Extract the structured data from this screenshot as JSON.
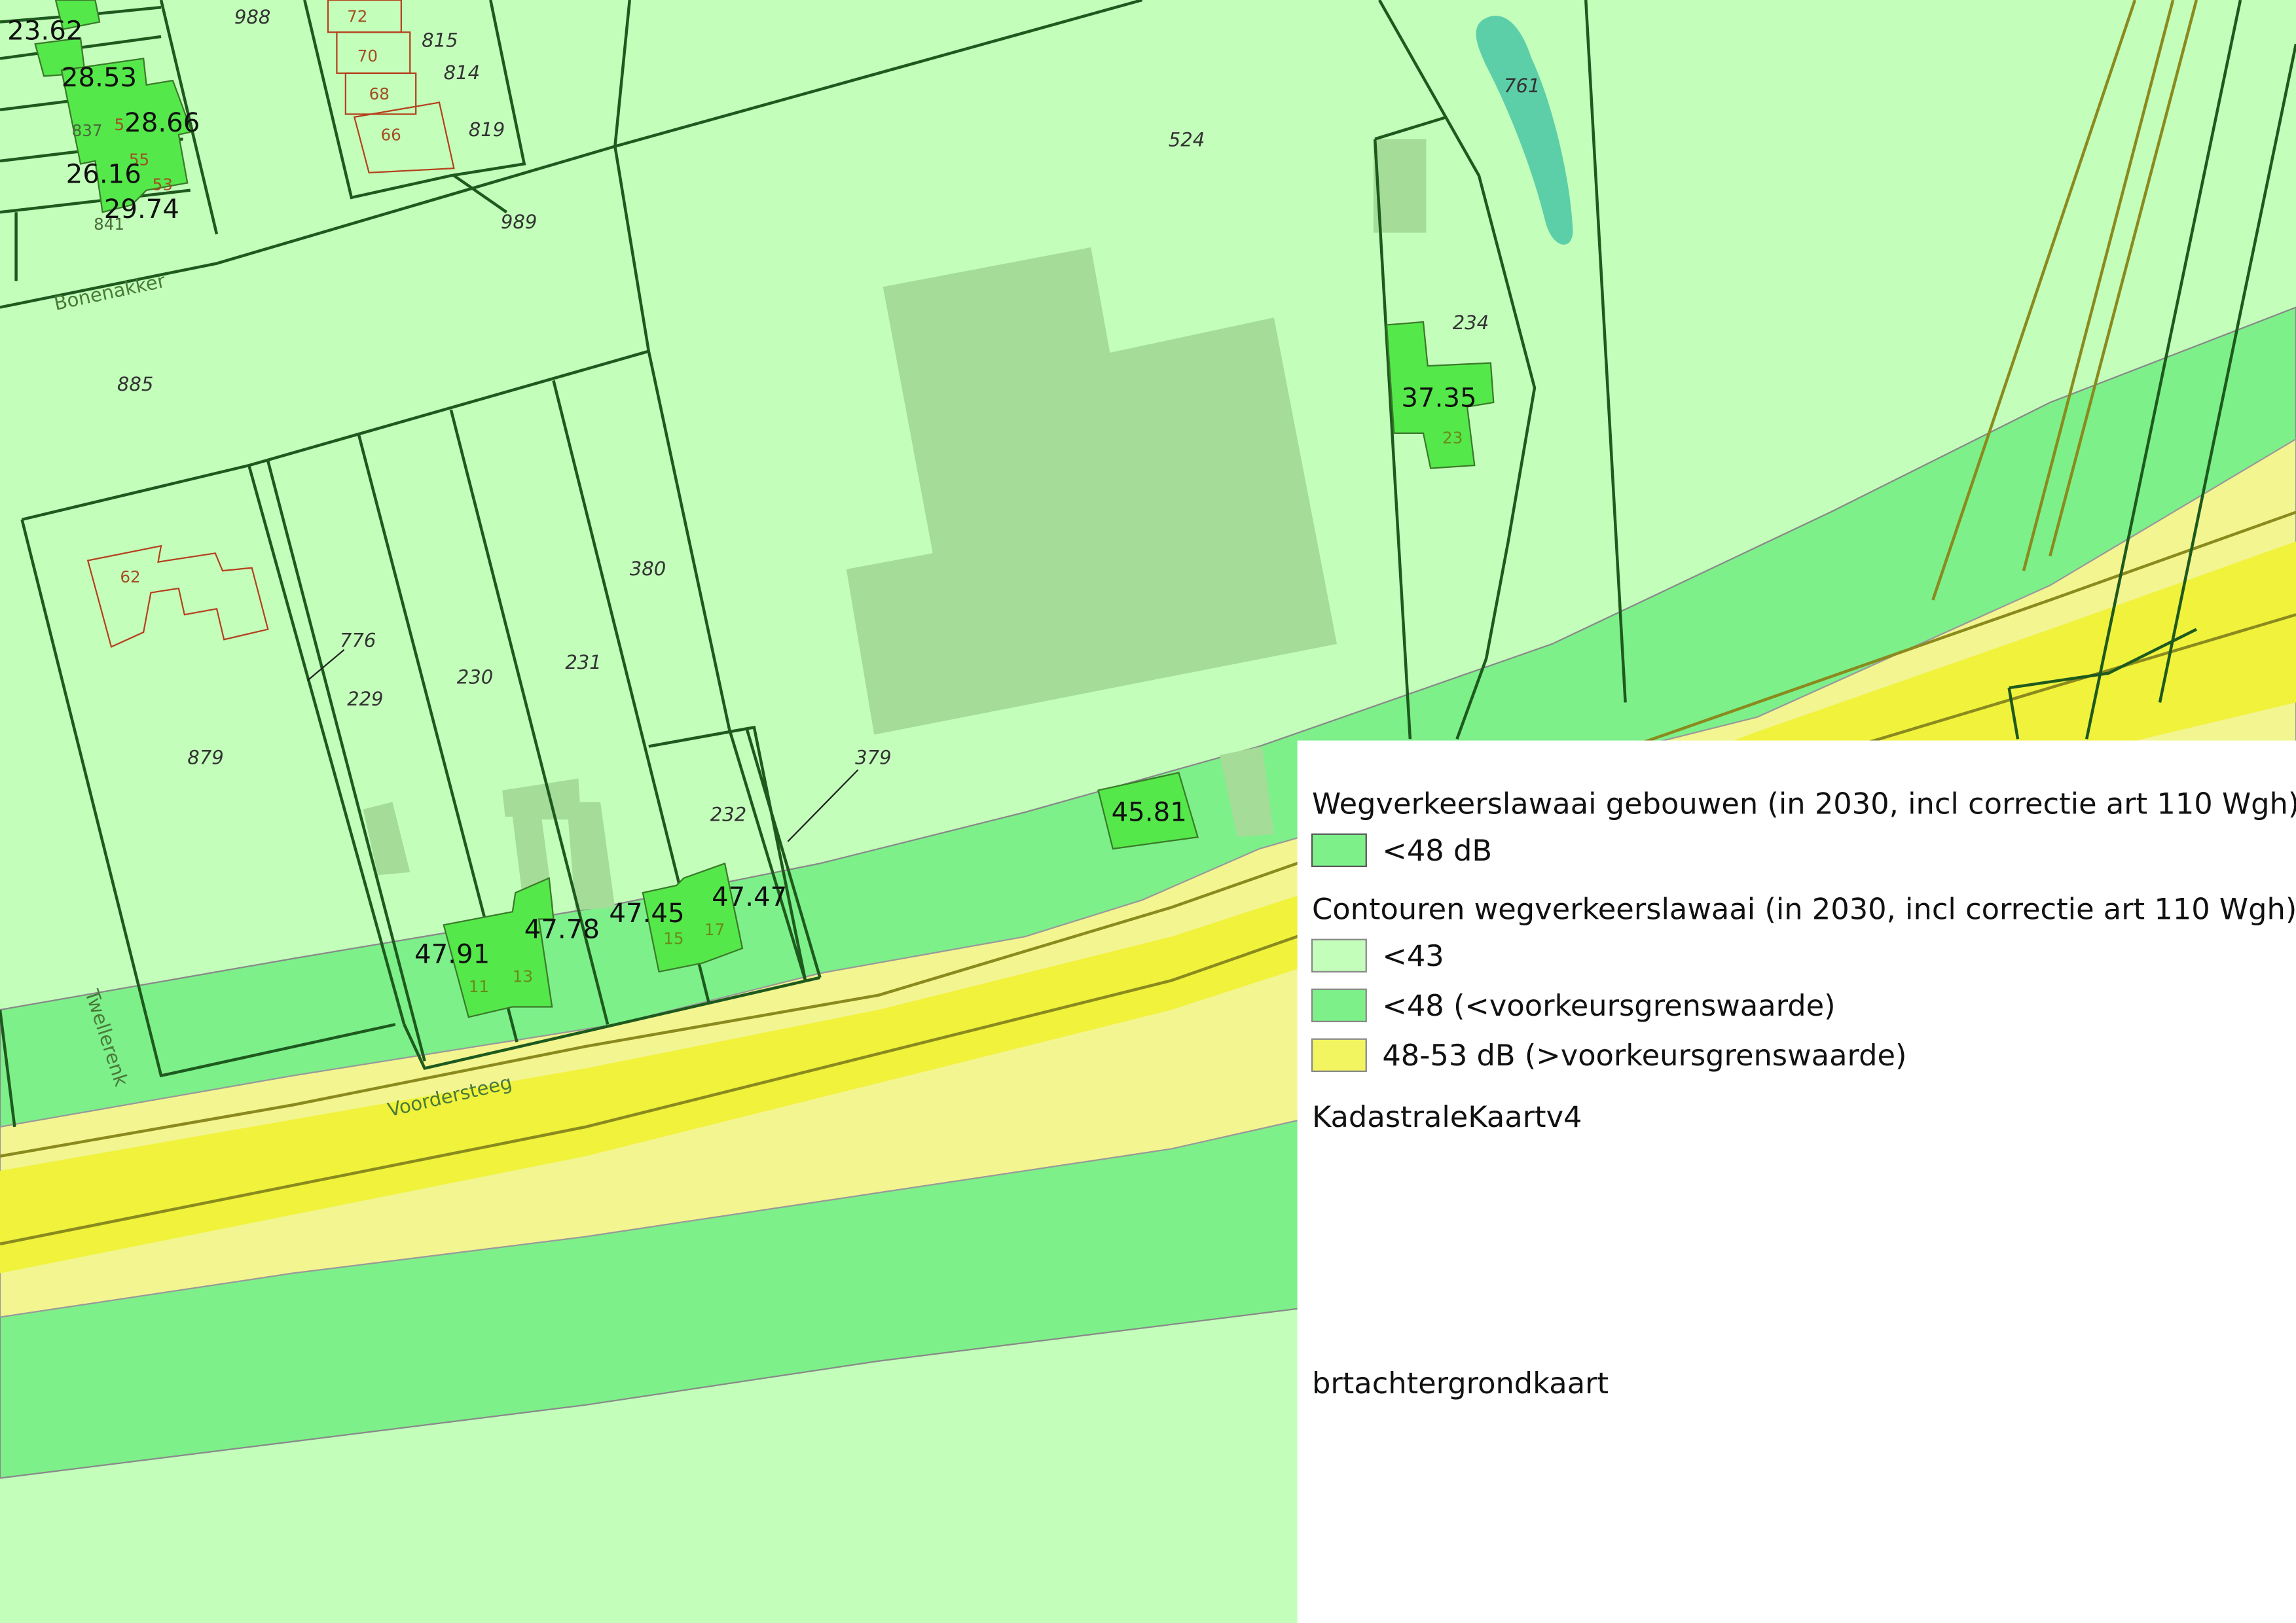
{
  "map": {
    "parcels": [
      "988",
      "815",
      "814",
      "819",
      "989",
      "524",
      "761",
      "234",
      "885",
      "380",
      "776",
      "229",
      "230",
      "231",
      "879",
      "232",
      "379"
    ],
    "house_numbers": [
      "72",
      "70",
      "68",
      "66",
      "53",
      "55",
      "62",
      "23",
      "11",
      "13",
      "15",
      "17",
      "837",
      "841",
      "5"
    ],
    "dB_labels": [
      "23.62",
      "28.53",
      "28.66",
      "26.16",
      "29.74",
      "37.35",
      "45.81",
      "47.91",
      "47.78",
      "47.45",
      "47.47"
    ],
    "streets": [
      "Bonenakker",
      "Twellerenk",
      "Voordersteeg"
    ]
  },
  "legend": {
    "group1_title": "Wegverkeerslawaai gebouwen (in 2030, incl correctie art 110 Wgh)",
    "group1_item": "<48 dB",
    "group2_title": "Contouren wegverkeerslawaai  (in 2030, incl correctie art 110 Wgh)",
    "group2_items": [
      "<43",
      "<48 (<voorkeursgrenswaarde)",
      "48-53 dB (>voorkeursgrenswaarde)"
    ],
    "layer3": "KadastraleKaartv4",
    "layer4": "brtachtergrondkaart"
  },
  "colors": {
    "zone_lt43": "#c3ffbb",
    "zone_lt48": "#7df08a",
    "zone_48_53": "#f0f474",
    "zone_48_53_core": "#f2f542",
    "building_lt48": "#55e84a",
    "outline_parcel": "#1e5a1e",
    "road": "#8a8a1e",
    "building_bg": "#a4dc98",
    "water": "#5dcfa8"
  }
}
